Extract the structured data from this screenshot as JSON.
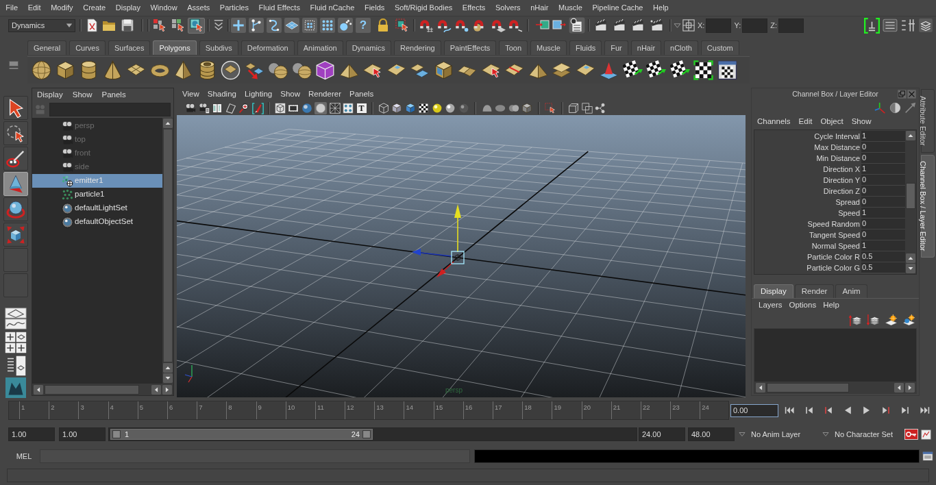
{
  "menu_bar": [
    "File",
    "Edit",
    "Modify",
    "Create",
    "Display",
    "Window",
    "Assets",
    "Particles",
    "Fluid Effects",
    "Fluid nCache",
    "Fields",
    "Soft/Rigid Bodies",
    "Effects",
    "Solvers",
    "nHair",
    "Muscle",
    "Pipeline Cache",
    "Help"
  ],
  "status_line": {
    "menu_set": "Dynamics",
    "selection_modes": [
      {
        "kind": "hierarchy",
        "selected": false
      },
      {
        "kind": "object",
        "selected": false
      },
      {
        "kind": "component",
        "selected": true
      }
    ],
    "help_button": "?",
    "coordinates": [
      {
        "label": "X:"
      },
      {
        "label": "Y:"
      },
      {
        "label": "Z:"
      }
    ]
  },
  "shelf": {
    "tabs": [
      {
        "label": "General",
        "selected": false
      },
      {
        "label": "Curves",
        "selected": false
      },
      {
        "label": "Surfaces",
        "selected": false
      },
      {
        "label": "Polygons",
        "selected": true
      },
      {
        "label": "Subdivs",
        "selected": false
      },
      {
        "label": "Deformation",
        "selected": false
      },
      {
        "label": "Animation",
        "selected": false
      },
      {
        "label": "Dynamics",
        "selected": false
      },
      {
        "label": "Rendering",
        "selected": false
      },
      {
        "label": "PaintEffects",
        "selected": false
      },
      {
        "label": "Toon",
        "selected": false
      },
      {
        "label": "Muscle",
        "selected": false
      },
      {
        "label": "Fluids",
        "selected": false
      },
      {
        "label": "Fur",
        "selected": false
      },
      {
        "label": "nHair",
        "selected": false
      },
      {
        "label": "nCloth",
        "selected": false
      },
      {
        "label": "Custom",
        "selected": false
      }
    ]
  },
  "toolbox": {
    "tools": [
      {
        "kind": "select",
        "selected": false
      },
      {
        "kind": "lasso",
        "selected": false
      },
      {
        "kind": "paint",
        "selected": false
      },
      {
        "kind": "move",
        "selected": true
      },
      {
        "kind": "rotate",
        "selected": false
      },
      {
        "kind": "scale",
        "selected": false
      },
      {
        "kind": "empty",
        "selected": false
      },
      {
        "kind": "empty",
        "selected": false
      }
    ]
  },
  "outliner": {
    "menus": [
      "Display",
      "Show",
      "Panels"
    ],
    "items": [
      {
        "label": "persp",
        "kind": "camera",
        "dimmed": true,
        "selected": false
      },
      {
        "label": "top",
        "kind": "camera",
        "dimmed": true,
        "selected": false
      },
      {
        "label": "front",
        "kind": "camera",
        "dimmed": true,
        "selected": false
      },
      {
        "label": "side",
        "kind": "camera",
        "dimmed": true,
        "selected": false
      },
      {
        "label": "emitter1",
        "kind": "emitter",
        "dimmed": false,
        "selected": true
      },
      {
        "label": "particle1",
        "kind": "particle",
        "dimmed": false,
        "selected": false
      },
      {
        "label": "defaultLightSet",
        "kind": "set",
        "dimmed": false,
        "selected": false
      },
      {
        "label": "defaultObjectSet",
        "kind": "set",
        "dimmed": false,
        "selected": false
      }
    ]
  },
  "viewport": {
    "menus": [
      "View",
      "Shading",
      "Lighting",
      "Show",
      "Renderer",
      "Panels"
    ],
    "text_toggle": "T",
    "camera_label": "persp"
  },
  "channel_box": {
    "title": "Channel Box / Layer Editor",
    "menus": [
      "Channels",
      "Edit",
      "Object",
      "Show"
    ],
    "attributes": [
      {
        "name": "Cycle Interval",
        "value": "1"
      },
      {
        "name": "Max Distance",
        "value": "0"
      },
      {
        "name": "Min Distance",
        "value": "0"
      },
      {
        "name": "Direction X",
        "value": "1"
      },
      {
        "name": "Direction Y",
        "value": "0"
      },
      {
        "name": "Direction Z",
        "value": "0"
      },
      {
        "name": "Spread",
        "value": "0"
      },
      {
        "name": "Speed",
        "value": "1"
      },
      {
        "name": "Speed Random",
        "value": "0"
      },
      {
        "name": "Tangent Speed",
        "value": "0"
      },
      {
        "name": "Normal Speed",
        "value": "1"
      },
      {
        "name": "Particle Color R",
        "value": "0.5"
      },
      {
        "name": "Particle Color G",
        "value": "0.5"
      }
    ]
  },
  "layer_editor": {
    "tabs": [
      {
        "label": "Display",
        "selected": true
      },
      {
        "label": "Render",
        "selected": false
      },
      {
        "label": "Anim",
        "selected": false
      }
    ],
    "menus": [
      "Layers",
      "Options",
      "Help"
    ]
  },
  "side_tabs": [
    {
      "label": "Attribute Editor",
      "selected": false
    },
    {
      "label": "Channel Box / Layer Editor",
      "selected": true
    }
  ],
  "time_slider": {
    "frames": [
      "1",
      "2",
      "3",
      "4",
      "5",
      "6",
      "7",
      "8",
      "9",
      "10",
      "11",
      "12",
      "13",
      "14",
      "15",
      "16",
      "17",
      "18",
      "19",
      "20",
      "21",
      "22",
      "23",
      "24"
    ],
    "level": 0,
    "current_time": "0.00"
  },
  "range_slider": {
    "start_time": "1.00",
    "playback_start": "1.00",
    "level": 0.5,
    "range_start": "1",
    "range_end": "24",
    "playback_end": "24.00",
    "end_time": "48.00",
    "anim_layer": "No Anim Layer",
    "character_set": "No Character Set"
  },
  "command_line": {
    "language": "MEL"
  }
}
